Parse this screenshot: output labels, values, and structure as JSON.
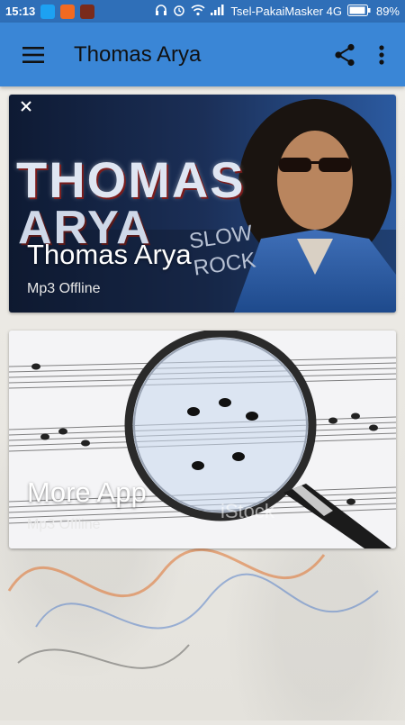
{
  "status_bar": {
    "time": "15:13",
    "carrier": "Tsel-PakaiMasker 4G",
    "battery": "89%"
  },
  "app_bar": {
    "title": "Thomas Arya"
  },
  "cards": [
    {
      "title": "Thomas Arya",
      "subtitle": "Mp3 Offline",
      "artwork_text": [
        "THOMAS",
        "ARYA",
        "SLOW",
        "ROCK"
      ]
    },
    {
      "title": "More App",
      "subtitle": "Mp3 Offline",
      "watermark": "iStock"
    }
  ],
  "colors": {
    "status_bar": "#2f6fb8",
    "app_bar": "#3a86d6"
  },
  "icons": [
    "menu-icon",
    "share-icon",
    "more-vert-icon",
    "close-icon"
  ]
}
